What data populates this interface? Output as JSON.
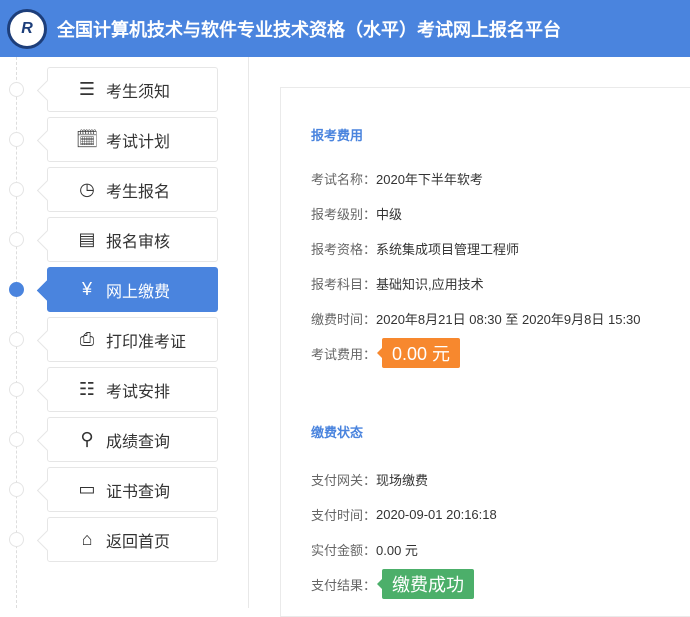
{
  "header": {
    "title": "全国计算机技术与软件专业技术资格（水平）考试网上报名平台",
    "logo_text": "R"
  },
  "nav": [
    {
      "label": "考生须知",
      "icon": "notice-board-icon",
      "glyph": "☰"
    },
    {
      "label": "考试计划",
      "icon": "schedule-clock-icon",
      "glyph": "🗓"
    },
    {
      "label": "考生报名",
      "icon": "clock-icon",
      "glyph": "◷"
    },
    {
      "label": "报名审核",
      "icon": "audit-document-icon",
      "glyph": "▤"
    },
    {
      "label": "网上缴费",
      "icon": "monitor-yen-icon",
      "glyph": "¥"
    },
    {
      "label": "打印准考证",
      "icon": "printer-icon",
      "glyph": "⎙"
    },
    {
      "label": "考试安排",
      "icon": "document-list-icon",
      "glyph": "☷"
    },
    {
      "label": "成绩查询",
      "icon": "magnifier-icon",
      "glyph": "⚲"
    },
    {
      "label": "证书查询",
      "icon": "certificate-icon",
      "glyph": "▭"
    },
    {
      "label": "返回首页",
      "icon": "home-icon",
      "glyph": "⌂"
    }
  ],
  "active_index": 4,
  "fee": {
    "title": "报考费用",
    "rows": [
      {
        "label": "考试名称：",
        "value": "2020年下半年软考"
      },
      {
        "label": "报考级别：",
        "value": "中级"
      },
      {
        "label": "报考资格：",
        "value": "系统集成项目管理工程师"
      },
      {
        "label": "报考科目：",
        "value": "基础知识,应用技术"
      },
      {
        "label": "缴费时间：",
        "value": "2020年8月21日 08:30 至 2020年9月8日 15:30"
      }
    ],
    "amount_label": "考试费用：",
    "amount": "0.00 元"
  },
  "status": {
    "title": "缴费状态",
    "rows": [
      {
        "label": "支付网关：",
        "value": "现场缴费"
      },
      {
        "label": "支付时间：",
        "value": "2020-09-01 20:16:18"
      },
      {
        "label": "实付金额：",
        "value": "0.00 元"
      }
    ],
    "result_label": "支付结果：",
    "result": "缴费成功"
  },
  "colors": {
    "primary": "#4a84de",
    "orange": "#f7882e",
    "green": "#4caf6a"
  }
}
